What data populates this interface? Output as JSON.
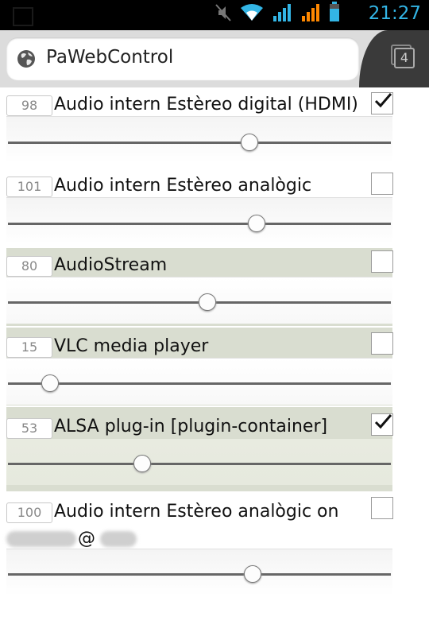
{
  "status_bar": {
    "time": "21:27",
    "icons": [
      "mute-icon",
      "wifi-icon",
      "signal-icon",
      "signal-roaming-icon",
      "battery-icon"
    ]
  },
  "browser": {
    "url": "PaWebControl",
    "tab_count": "4"
  },
  "streams": [
    {
      "volume": "98",
      "name": "Audio intern Estèreo digital (HDMI)",
      "checked": true,
      "slider": 0.63,
      "shaded": false
    },
    {
      "volume": "101",
      "name": "Audio intern Estèreo analògic",
      "checked": false,
      "slider": 0.65,
      "shaded": false
    },
    {
      "volume": "80",
      "name": "AudioStream",
      "checked": false,
      "slider": 0.52,
      "shaded": true
    },
    {
      "volume": "15",
      "name": "VLC media player",
      "checked": false,
      "slider": 0.11,
      "shaded": true
    },
    {
      "volume": "53",
      "name": "ALSA plug-in [plugin-container]",
      "checked": true,
      "slider": 0.35,
      "shaded": true
    },
    {
      "volume": "100",
      "name": "Audio intern Estèreo analògic on",
      "name_line2": "@",
      "checked": false,
      "slider": 0.64,
      "shaded": false
    }
  ],
  "colors": {
    "accent": "#33b5e5",
    "shaded_row": "#d9ddd0"
  }
}
